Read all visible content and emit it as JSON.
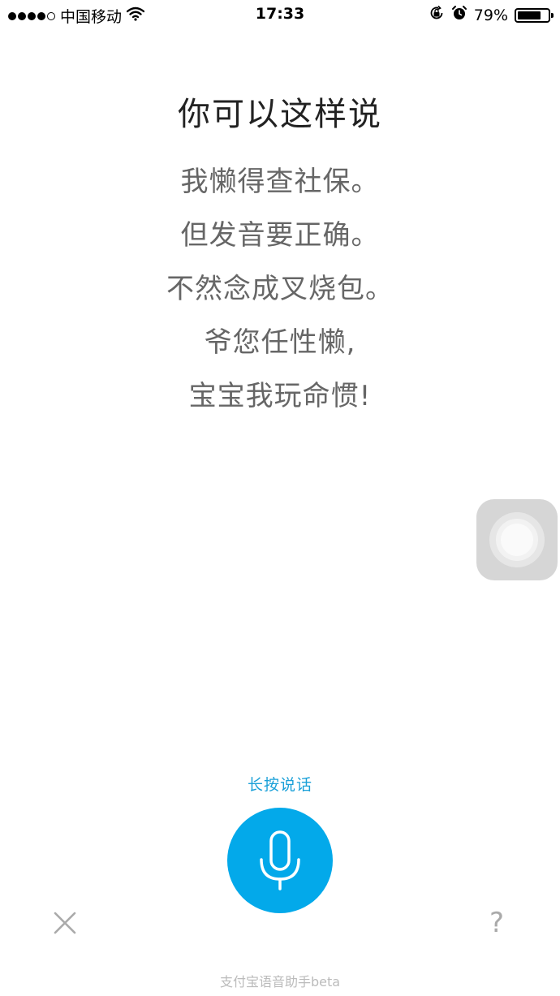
{
  "status_bar": {
    "carrier": "中国移动",
    "time": "17:33",
    "battery_percent": "79%",
    "battery_level": 0.79,
    "signal_filled": 4,
    "signal_total": 5
  },
  "main": {
    "title": "你可以这样说",
    "lines": [
      "我懒得查社保。",
      "但发音要正确。",
      "不然念成叉烧包。",
      "爷您任性懒,",
      "宝宝我玩命惯!"
    ]
  },
  "voice": {
    "hint": "长按说话",
    "help_label": "?"
  },
  "footer": {
    "label": "支付宝语音助手beta"
  },
  "colors": {
    "accent": "#03a9ea",
    "hint_text": "#1aa0d8"
  }
}
